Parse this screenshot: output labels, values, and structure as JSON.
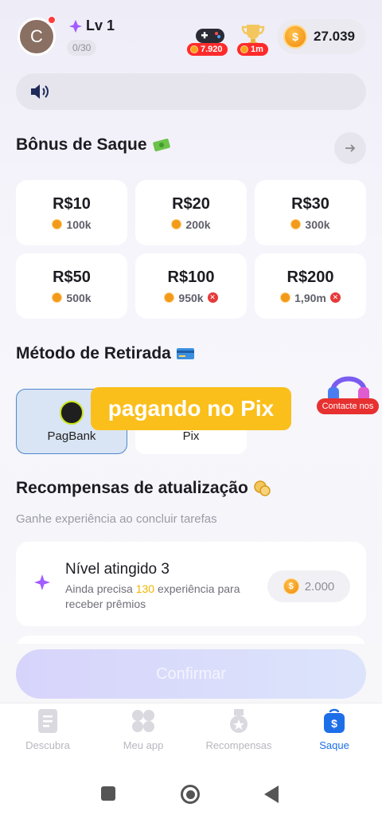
{
  "header": {
    "avatar_letter": "C",
    "level_label": "Lv 1",
    "xp_label": "0/30",
    "game_badge": "7.920",
    "trophy_badge": "1m",
    "coin_balance": "27.039",
    "coin_symbol": "$"
  },
  "announcement": {
    "icon": "speaker-icon",
    "text": ""
  },
  "bonus": {
    "title": "Bônus de Saque",
    "title_icon": "money-icon",
    "cards": [
      {
        "amount": "R$10",
        "points": "100k",
        "locked": false
      },
      {
        "amount": "R$20",
        "points": "200k",
        "locked": false
      },
      {
        "amount": "R$30",
        "points": "300k",
        "locked": false
      },
      {
        "amount": "R$50",
        "points": "500k",
        "locked": false
      },
      {
        "amount": "R$100",
        "points": "950k",
        "locked": true
      },
      {
        "amount": "R$200",
        "points": "1,90m",
        "locked": true
      }
    ]
  },
  "withdraw": {
    "title": "Método de Retirada",
    "title_icon": "card-icon",
    "methods": [
      {
        "label": "PagBank",
        "selected": true
      },
      {
        "label": "Pix",
        "selected": false
      }
    ],
    "overlay_text": "pagando no Pix"
  },
  "contact": {
    "label": "Contacte nos"
  },
  "rewards": {
    "title": "Recompensas de atualização",
    "subtitle": "Ganhe experiência ao concluir tarefas",
    "item": {
      "title": "Nível atingido 3",
      "desc_prefix": "Ainda precisa",
      "desc_value": "130",
      "desc_suffix": "experiência para receber prêmios",
      "reward": "2.000"
    }
  },
  "confirm_label": "Confirmar",
  "nav": [
    {
      "label": "Descubra",
      "icon": "document-icon",
      "active": false
    },
    {
      "label": "Meu app",
      "icon": "grid-icon",
      "active": false
    },
    {
      "label": "Recompensas",
      "icon": "medal-icon",
      "active": false
    },
    {
      "label": "Saque",
      "icon": "wallet-icon",
      "active": true
    }
  ],
  "colors": {
    "accent": "#1d6fe8",
    "overlay": "#fbbf1b",
    "alert": "#e73030"
  }
}
